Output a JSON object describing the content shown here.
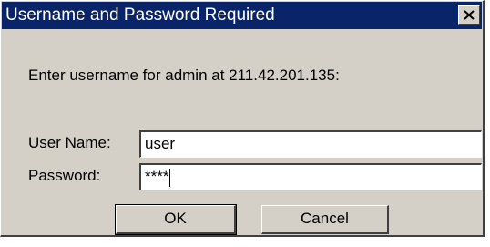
{
  "window": {
    "title": "Username and Password Required",
    "close_icon": "close-icon"
  },
  "prompt": "Enter username for admin at 211.42.201.135:",
  "fields": {
    "username_label": "User Name:",
    "username_value": "user",
    "password_label": "Password:",
    "password_value": "****"
  },
  "buttons": {
    "ok": "OK",
    "cancel": "Cancel"
  },
  "colors": {
    "titlebar": "#0a246a",
    "dialog_bg": "#d4d0c8"
  }
}
